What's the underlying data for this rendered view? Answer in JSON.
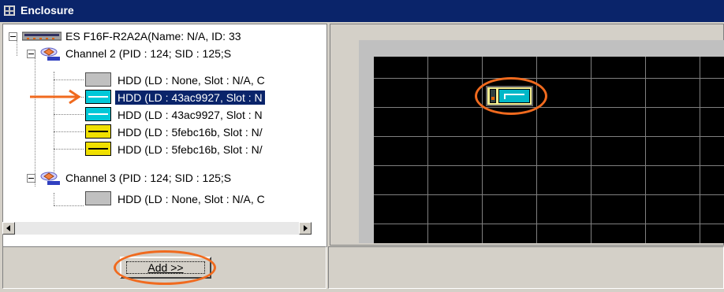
{
  "window": {
    "title": "Enclosure"
  },
  "tree": {
    "items": [
      {
        "label": "ES F16F-R2A2A(Name: N/A, ID: 33",
        "icon": "enclosure-icon",
        "level": 0
      },
      {
        "label": "Channel 2 (PID : 124; SID : 125;S",
        "icon": "channel-icon",
        "level": 1
      },
      {
        "label": "HDD  (LD : None, Slot : N/A, C",
        "icon": "hdd-gray-icon",
        "level": 2
      },
      {
        "label": "HDD  (LD : 43ac9927, Slot : N",
        "icon": "hdd-cyan-icon",
        "level": 2,
        "selected": true
      },
      {
        "label": "HDD  (LD : 43ac9927, Slot : N",
        "icon": "hdd-cyan-icon",
        "level": 2
      },
      {
        "label": "HDD  (LD : 5febc16b, Slot : N/",
        "icon": "hdd-yellow-icon",
        "level": 2
      },
      {
        "label": "HDD  (LD : 5febc16b, Slot : N/",
        "icon": "hdd-yellow-icon",
        "level": 2
      },
      {
        "label": "Channel 3 (PID : 124; SID : 125;S",
        "icon": "channel-icon",
        "level": 1
      },
      {
        "label": "HDD  (LD : None, Slot : N/A, C",
        "icon": "hdd-gray-icon",
        "level": 2
      }
    ]
  },
  "add_button": {
    "label": "Add >>"
  },
  "colors": {
    "title_bar": "#0a246a",
    "selection": "#0a246a",
    "annotation": "#f06a1e",
    "grid_background": "#000000",
    "hdd_cyan": "#00c8d8",
    "hdd_yellow": "#f0e000",
    "hdd_gray": "#c0c0c0"
  }
}
